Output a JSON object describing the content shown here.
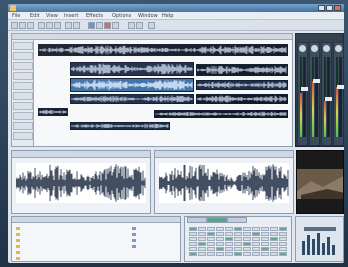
{
  "window": {
    "title": "",
    "app_icon": "app-icon"
  },
  "menu": {
    "items": [
      "File",
      "Edit",
      "View",
      "Insert",
      "Effects",
      "Options",
      "Window",
      "Help"
    ]
  },
  "toolbar": {
    "buttons": [
      "new-icon",
      "open-icon",
      "save-icon",
      "cut-icon",
      "copy-icon",
      "paste-icon",
      "undo-icon",
      "redo-icon",
      "play-icon",
      "stop-icon",
      "record-icon",
      "loop-icon",
      "zoom-in-icon",
      "zoom-out-icon",
      "snap-icon"
    ]
  },
  "multitrack": {
    "track_labels": [
      "",
      "",
      "",
      "",
      "",
      "",
      "",
      "",
      "",
      "",
      ""
    ],
    "status_text": ""
  },
  "mixer": {
    "title": "",
    "channels": 4,
    "levels": [
      0.55,
      0.7,
      0.45,
      0.62
    ]
  },
  "editor_left": {
    "title": ""
  },
  "editor_right": {
    "title": ""
  },
  "browser": {
    "title": "",
    "files": [
      "",
      "",
      "",
      "",
      "",
      ""
    ],
    "files_right": [
      "",
      "",
      "",
      ""
    ]
  },
  "props": {
    "tabs": [
      "",
      "",
      ""
    ]
  },
  "colors": {
    "clip": "#1b2a45",
    "clip_selected": "#3a6fa6",
    "accent_green": "#5fa38a",
    "frame": "#2a3a4c"
  }
}
